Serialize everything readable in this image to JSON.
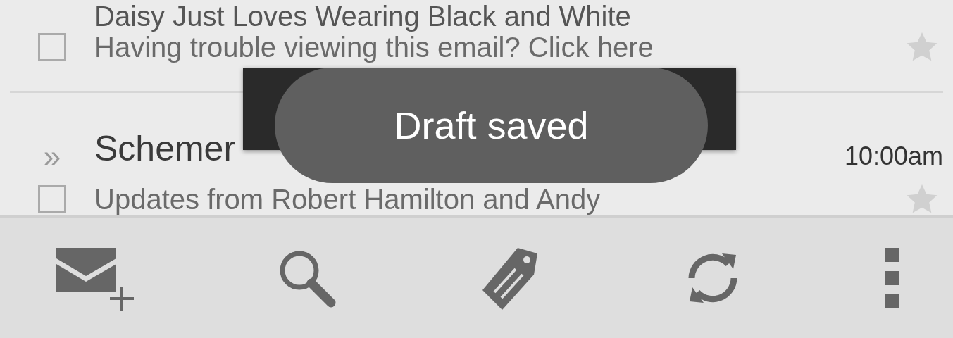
{
  "messages": [
    {
      "title": "Daisy Just Loves Wearing Black and White",
      "snippet": "Having trouble viewing this email? Click here",
      "checked": false,
      "starred": false
    },
    {
      "marker": "»",
      "title": "Schemer",
      "time": "10:00am",
      "snippet": "Updates from Robert Hamilton and Andy",
      "checked": false,
      "starred": false
    }
  ],
  "toast": {
    "text": "Draft saved"
  },
  "toolbar": [
    {
      "kind": "compose"
    },
    {
      "kind": "search"
    },
    {
      "kind": "label"
    },
    {
      "kind": "refresh"
    },
    {
      "kind": "overflow"
    }
  ]
}
